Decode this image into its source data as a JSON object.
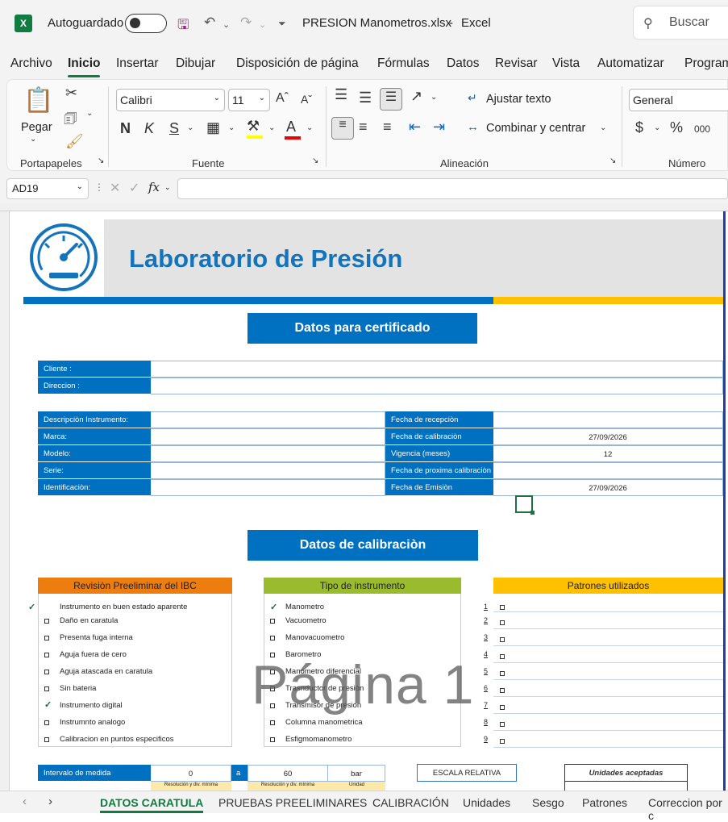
{
  "titlebar": {
    "autosave_label": "Autoguardado",
    "filename": "PRESION Manometros.xlsx",
    "app": "Excel",
    "separator": "-",
    "search_label": "Buscar"
  },
  "menu": [
    "Archivo",
    "Inicio",
    "Insertar",
    "Dibujar",
    "Disposición de página",
    "Fórmulas",
    "Datos",
    "Revisar",
    "Vista",
    "Automatizar",
    "Program"
  ],
  "ribbon": {
    "paste_label": "Pegar",
    "clipboard_label": "Portapapeles",
    "font_name": "Calibri",
    "font_size": "11",
    "font_label": "Fuente",
    "bold": "N",
    "italic": "K",
    "underline": "S",
    "wrap_label": "Ajustar texto",
    "merge_label": "Combinar y centrar",
    "align_label": "Alineación",
    "number_format": "General",
    "number_label": "Número",
    "percent": "%",
    "currency": "$",
    "thousands": "000"
  },
  "formula": {
    "cell_ref": "AD19",
    "fx": "fx"
  },
  "sheet": {
    "lab_title": "Laboratorio de Presión",
    "cert_title": "Datos para certificado",
    "client_label": "Cliente :",
    "address_label": "Direccion :",
    "left_labels": [
      "Descripciòn Instrumento:",
      "Marca:",
      "Modelo:",
      "Serie:",
      "Identificaciòn:"
    ],
    "right_labels": [
      "Fecha de recepciòn",
      "Fecha de calibraciòn",
      "Vigencia (meses)",
      "Fecha de proxima calibraciòn",
      "Fecha de Emisiòn"
    ],
    "right_values": [
      "",
      "27/09/2026",
      "12",
      "",
      "27/09/2026"
    ],
    "calib_title": "Datos de calibraciòn",
    "rev_header": "Revisiòn Preeliminar del IBC",
    "rev_items": [
      "Instrumento en buen estado aparente",
      "Daño en caratula",
      "Presenta fuga interna",
      "Aguja fuera de cero",
      "Aguja atascada en caratula",
      "Sin bateria",
      "Instrumento digital",
      "Instrumnto analogo",
      "Calibracion en puntos especificos"
    ],
    "type_header": "Tipo de instrumento",
    "type_items": [
      "Manometro",
      "Vacuometro",
      "Manovacuometro",
      "Barometro",
      "Manometro diferencial",
      "Trasnductor de presiòn",
      "Transmisor de presion",
      "Columna manometrica",
      "Esfigmomanometro"
    ],
    "patterns_header": "Patrones utilizados",
    "pattern_numbers": [
      "1",
      "2",
      "3",
      "4",
      "5",
      "6",
      "7",
      "8",
      "9"
    ],
    "interval_label": "Intervalo de medida",
    "interval_min": "0",
    "interval_sep": "a",
    "interval_max": "60",
    "interval_unit": "bar",
    "scale_label": "ESCALA RELATIVA",
    "units_label": "Unidades aceptadas",
    "sub_headers": [
      "Resolución y div. mínima",
      "Resolución y div. mínima",
      "Unidad"
    ],
    "watermark": "Página 1"
  },
  "tabs": [
    "DATOS CARATULA",
    "PRUEBAS PREELIMINARES",
    "CALIBRACIÓN",
    "Unidades",
    "Sesgo",
    "Patrones",
    "Correccion por c"
  ],
  "colors": {
    "blue": "#0070c0",
    "gold": "#ffc000",
    "orange": "#ed7d0f",
    "green": "#9bbb2e",
    "excel_green": "#107c41"
  }
}
